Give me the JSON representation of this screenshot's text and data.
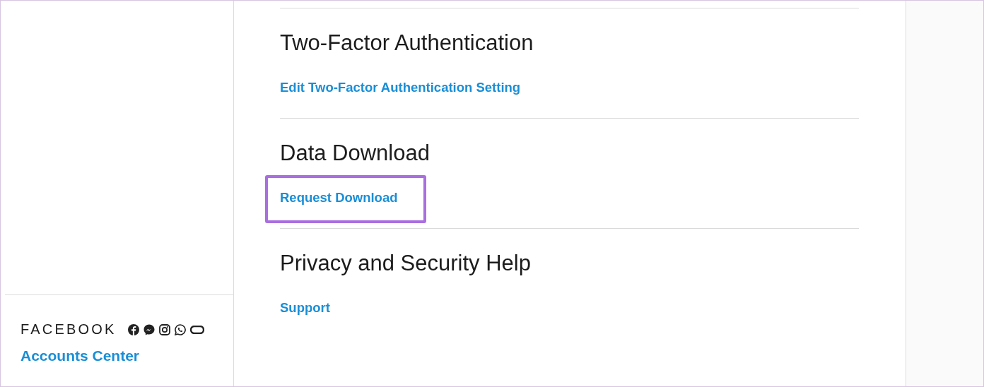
{
  "sidebar": {
    "brand": "FACEBOOK",
    "brand_icons": [
      {
        "kind": "facebook"
      },
      {
        "kind": "messenger"
      },
      {
        "kind": "instagram"
      },
      {
        "kind": "whatsapp"
      },
      {
        "kind": "oculus"
      }
    ],
    "accounts_link": "Accounts Center"
  },
  "sections": [
    {
      "heading": "Two-Factor Authentication",
      "link": "Edit Two-Factor Authentication Setting",
      "highlighted": false
    },
    {
      "heading": "Data Download",
      "link": "Request Download",
      "highlighted": true
    },
    {
      "heading": "Privacy and Security Help",
      "link": "Support",
      "highlighted": false
    }
  ]
}
